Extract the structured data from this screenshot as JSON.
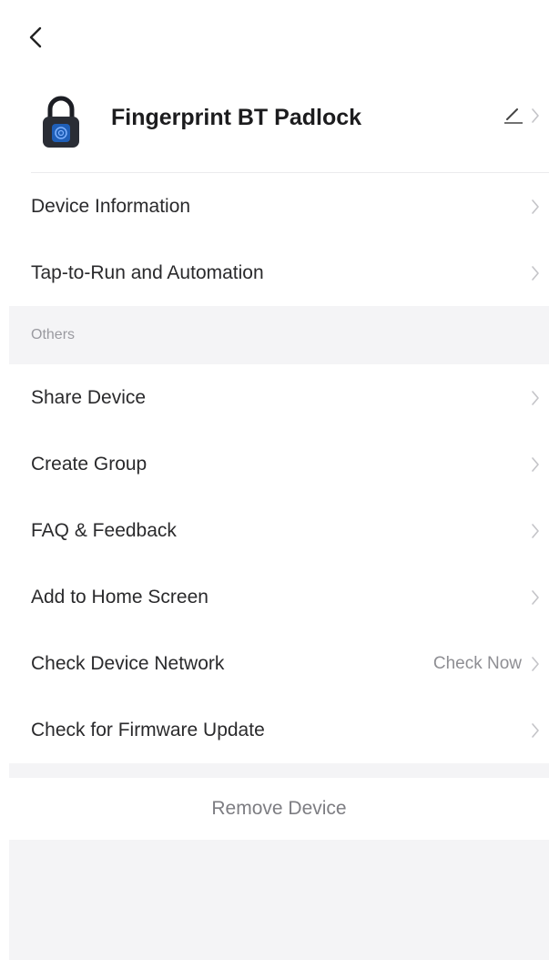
{
  "device": {
    "name": "Fingerprint BT Padlock"
  },
  "rows_top": [
    {
      "label": "Device Information",
      "value": ""
    },
    {
      "label": "Tap-to-Run and Automation",
      "value": ""
    }
  ],
  "others": {
    "header": "Others",
    "rows": [
      {
        "label": "Share Device",
        "value": ""
      },
      {
        "label": "Create Group",
        "value": ""
      },
      {
        "label": "FAQ & Feedback",
        "value": ""
      },
      {
        "label": "Add to Home Screen",
        "value": ""
      },
      {
        "label": "Check Device Network",
        "value": "Check Now"
      },
      {
        "label": "Check for Firmware Update",
        "value": ""
      }
    ]
  },
  "remove": {
    "label": "Remove Device"
  },
  "icons": {
    "back": "chevron-left-icon",
    "device": "padlock-icon",
    "edit": "pencil-icon",
    "chevron": "chevron-right-icon"
  },
  "colors": {
    "background": "#f4f4f6",
    "surface": "#ffffff",
    "text_primary": "#2a2a2c",
    "text_secondary": "#8e8e93"
  }
}
